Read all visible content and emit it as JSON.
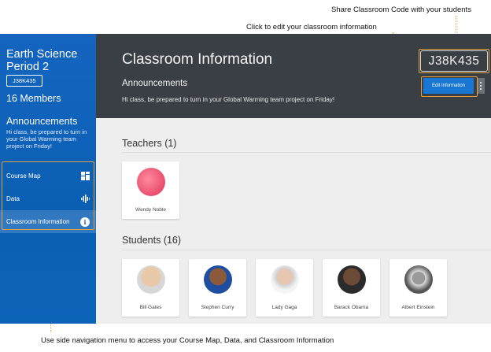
{
  "callouts": {
    "share_code": "Share Classroom Code with your students",
    "edit_info": "Click to edit your classroom information",
    "side_nav": "Use side navigation menu to access your Course Map, Data, and Classroom Information"
  },
  "sidebar": {
    "class_name": "Earth Science Period 2",
    "class_code": "J38K435",
    "members": "16 Members",
    "announcements_title": "Announcements",
    "announcements_text": "Hi class, be prepared to turn in your Global Warming team project on Friday!",
    "nav": [
      {
        "label": "Course Map",
        "icon": "grid-icon"
      },
      {
        "label": "Data",
        "icon": "waveform-icon"
      },
      {
        "label": "Classroom Information",
        "icon": "info-icon"
      }
    ]
  },
  "header": {
    "title": "Classroom Information",
    "announcements_title": "Announcements",
    "announcements_text": "Hi class, be prepared to turn in your Global Warming team project on Friday!",
    "class_code": "J38K435",
    "edit_button": "Edit Information"
  },
  "teachers": {
    "title": "Teachers (1)",
    "list": [
      {
        "name": "Wendy Noble"
      }
    ]
  },
  "students": {
    "title": "Students (16)",
    "list": [
      {
        "name": "Bill Gates"
      },
      {
        "name": "Stephen Curry"
      },
      {
        "name": "Lady Gaga"
      },
      {
        "name": "Barack Obama"
      },
      {
        "name": "Albert Einstein"
      }
    ]
  },
  "colors": {
    "sidebar_blue": "#1565c0",
    "header_dark": "#3a3f45",
    "button_blue": "#1976d2",
    "highlight_orange": "#e8a33a"
  }
}
